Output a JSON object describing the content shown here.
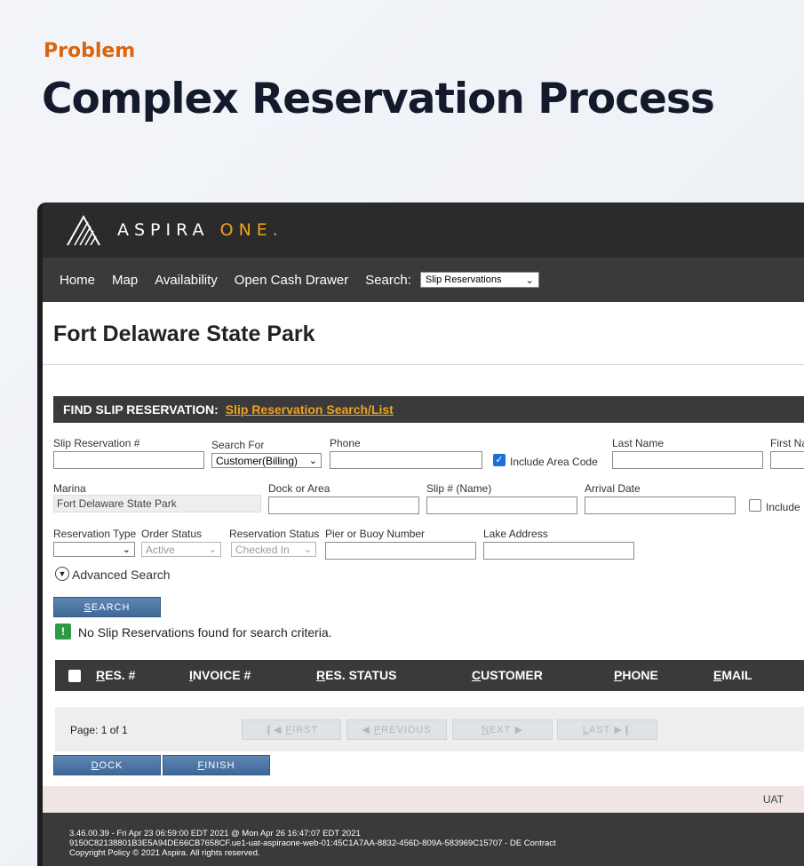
{
  "eyebrow": "Problem",
  "headline": "Complex Reservation Process",
  "app": {
    "brand_part1": "ASPIRA",
    "brand_part2": "ONE",
    "brand_dot": ".",
    "nav": [
      "Home",
      "Map",
      "Availability",
      "Open Cash Drawer"
    ],
    "search_label": "Search:",
    "search_select": "Slip Reservations"
  },
  "park_title": "Fort Delaware State Park",
  "find": {
    "label": "FIND SLIP RESERVATION:",
    "link": "Slip Reservation Search/List"
  },
  "form": {
    "slip_res_label": "Slip Reservation #",
    "search_for_label": "Search For",
    "search_for_value": "Customer(Billing)",
    "phone_label": "Phone",
    "include_area_code": "Include Area Code",
    "last_name_label": "Last Name",
    "first_name_label": "First Na",
    "marina_label": "Marina",
    "marina_value": "Fort Delaware State Park",
    "dock_label": "Dock or Area",
    "slip_name_label": "Slip # (Name)",
    "arrival_label": "Arrival Date",
    "include_label": "Include I",
    "res_type_label": "Reservation Type",
    "order_status_label": "Order Status",
    "order_status_value": "Active",
    "res_status_label": "Reservation Status",
    "res_status_value": "Checked In",
    "pier_label": "Pier or Buoy Number",
    "lake_label": "Lake Address",
    "advanced_search": "Advanced Search"
  },
  "search_button": {
    "accel": "S",
    "rest": "EARCH"
  },
  "message": "No Slip Reservations found for search criteria.",
  "table_headers": [
    {
      "accel": "R",
      "rest": "ES. #"
    },
    {
      "accel": "I",
      "rest": "NVOICE #"
    },
    {
      "accel": "R",
      "rest": "ES. STATUS"
    },
    {
      "accel": "C",
      "rest": "USTOMER"
    },
    {
      "accel": "P",
      "rest": "HONE"
    },
    {
      "accel": "E",
      "rest": "MAIL"
    }
  ],
  "pager": {
    "page_text": "Page: 1 of 1",
    "first": {
      "accel": "F",
      "rest": "IRST"
    },
    "previous": {
      "accel": "P",
      "rest": "REVIOUS"
    },
    "next": {
      "accel": "N",
      "rest": "EXT"
    },
    "last": {
      "accel": "L",
      "rest": "AST"
    }
  },
  "dock_button": {
    "accel": "D",
    "rest": "OCK"
  },
  "finish_button": {
    "accel": "F",
    "rest": "INISH"
  },
  "env_label": "UAT",
  "footer": {
    "line1": "3.46.00.39 - Fri Apr 23 06:59:00 EDT 2021 @ Mon Apr 26 16:47:07 EDT 2021",
    "line2": "9150C82138801B3E5A94DE66CB7658CF.ue1-uat-aspiraone-web-01:45C1A7AA-8832-456D-809A-583969C15707 - DE Contract",
    "line3": "Copyright Policy    © 2021 Aspira. All rights reserved."
  },
  "colors": {
    "accent_orange": "#d9660f",
    "brand_gold": "#f0a21d",
    "header_dark": "#3a3a3a",
    "button_blue": "#4a74a3"
  }
}
